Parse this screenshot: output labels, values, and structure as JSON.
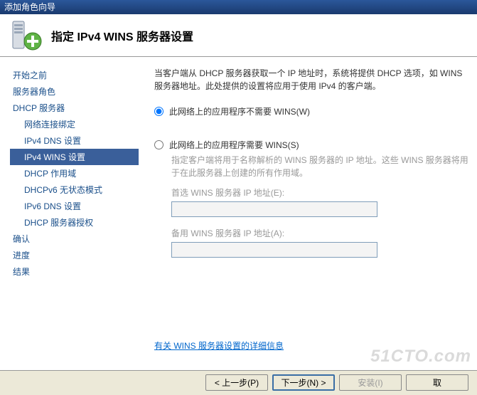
{
  "window": {
    "title": "添加角色向导"
  },
  "header": {
    "title": "指定 IPv4 WINS 服务器设置"
  },
  "sidebar": {
    "items": [
      {
        "label": "开始之前"
      },
      {
        "label": "服务器角色"
      },
      {
        "label": "DHCP 服务器"
      },
      {
        "label": "网络连接绑定"
      },
      {
        "label": "IPv4 DNS 设置"
      },
      {
        "label": "IPv4 WINS 设置"
      },
      {
        "label": "DHCP 作用域"
      },
      {
        "label": "DHCPv6 无状态模式"
      },
      {
        "label": "IPv6 DNS 设置"
      },
      {
        "label": "DHCP 服务器授权"
      },
      {
        "label": "确认"
      },
      {
        "label": "进度"
      },
      {
        "label": "结果"
      }
    ]
  },
  "content": {
    "description": "当客户端从 DHCP 服务器获取一个 IP 地址时，系统将提供 DHCP 选项，如 WINS 服务器地址。此处提供的设置将应用于使用 IPv4 的客户端。",
    "radio1": "此网络上的应用程序不需要 WINS(W)",
    "radio2": "此网络上的应用程序需要 WINS(S)",
    "subdesc": "指定客户端将用于名称解析的 WINS 服务器的 IP 地址。这些 WINS 服务器将用于在此服务器上创建的所有作用域。",
    "pref_label": "首选 WINS 服务器 IP 地址(E):",
    "pref_value": "",
    "alt_label": "备用 WINS 服务器 IP 地址(A):",
    "alt_value": "",
    "link": "有关 WINS 服务器设置的详细信息"
  },
  "footer": {
    "prev": "< 上一步(P)",
    "next": "下一步(N) >",
    "install": "安装(I)",
    "cancel": "取"
  },
  "watermark": "51CTO.com"
}
